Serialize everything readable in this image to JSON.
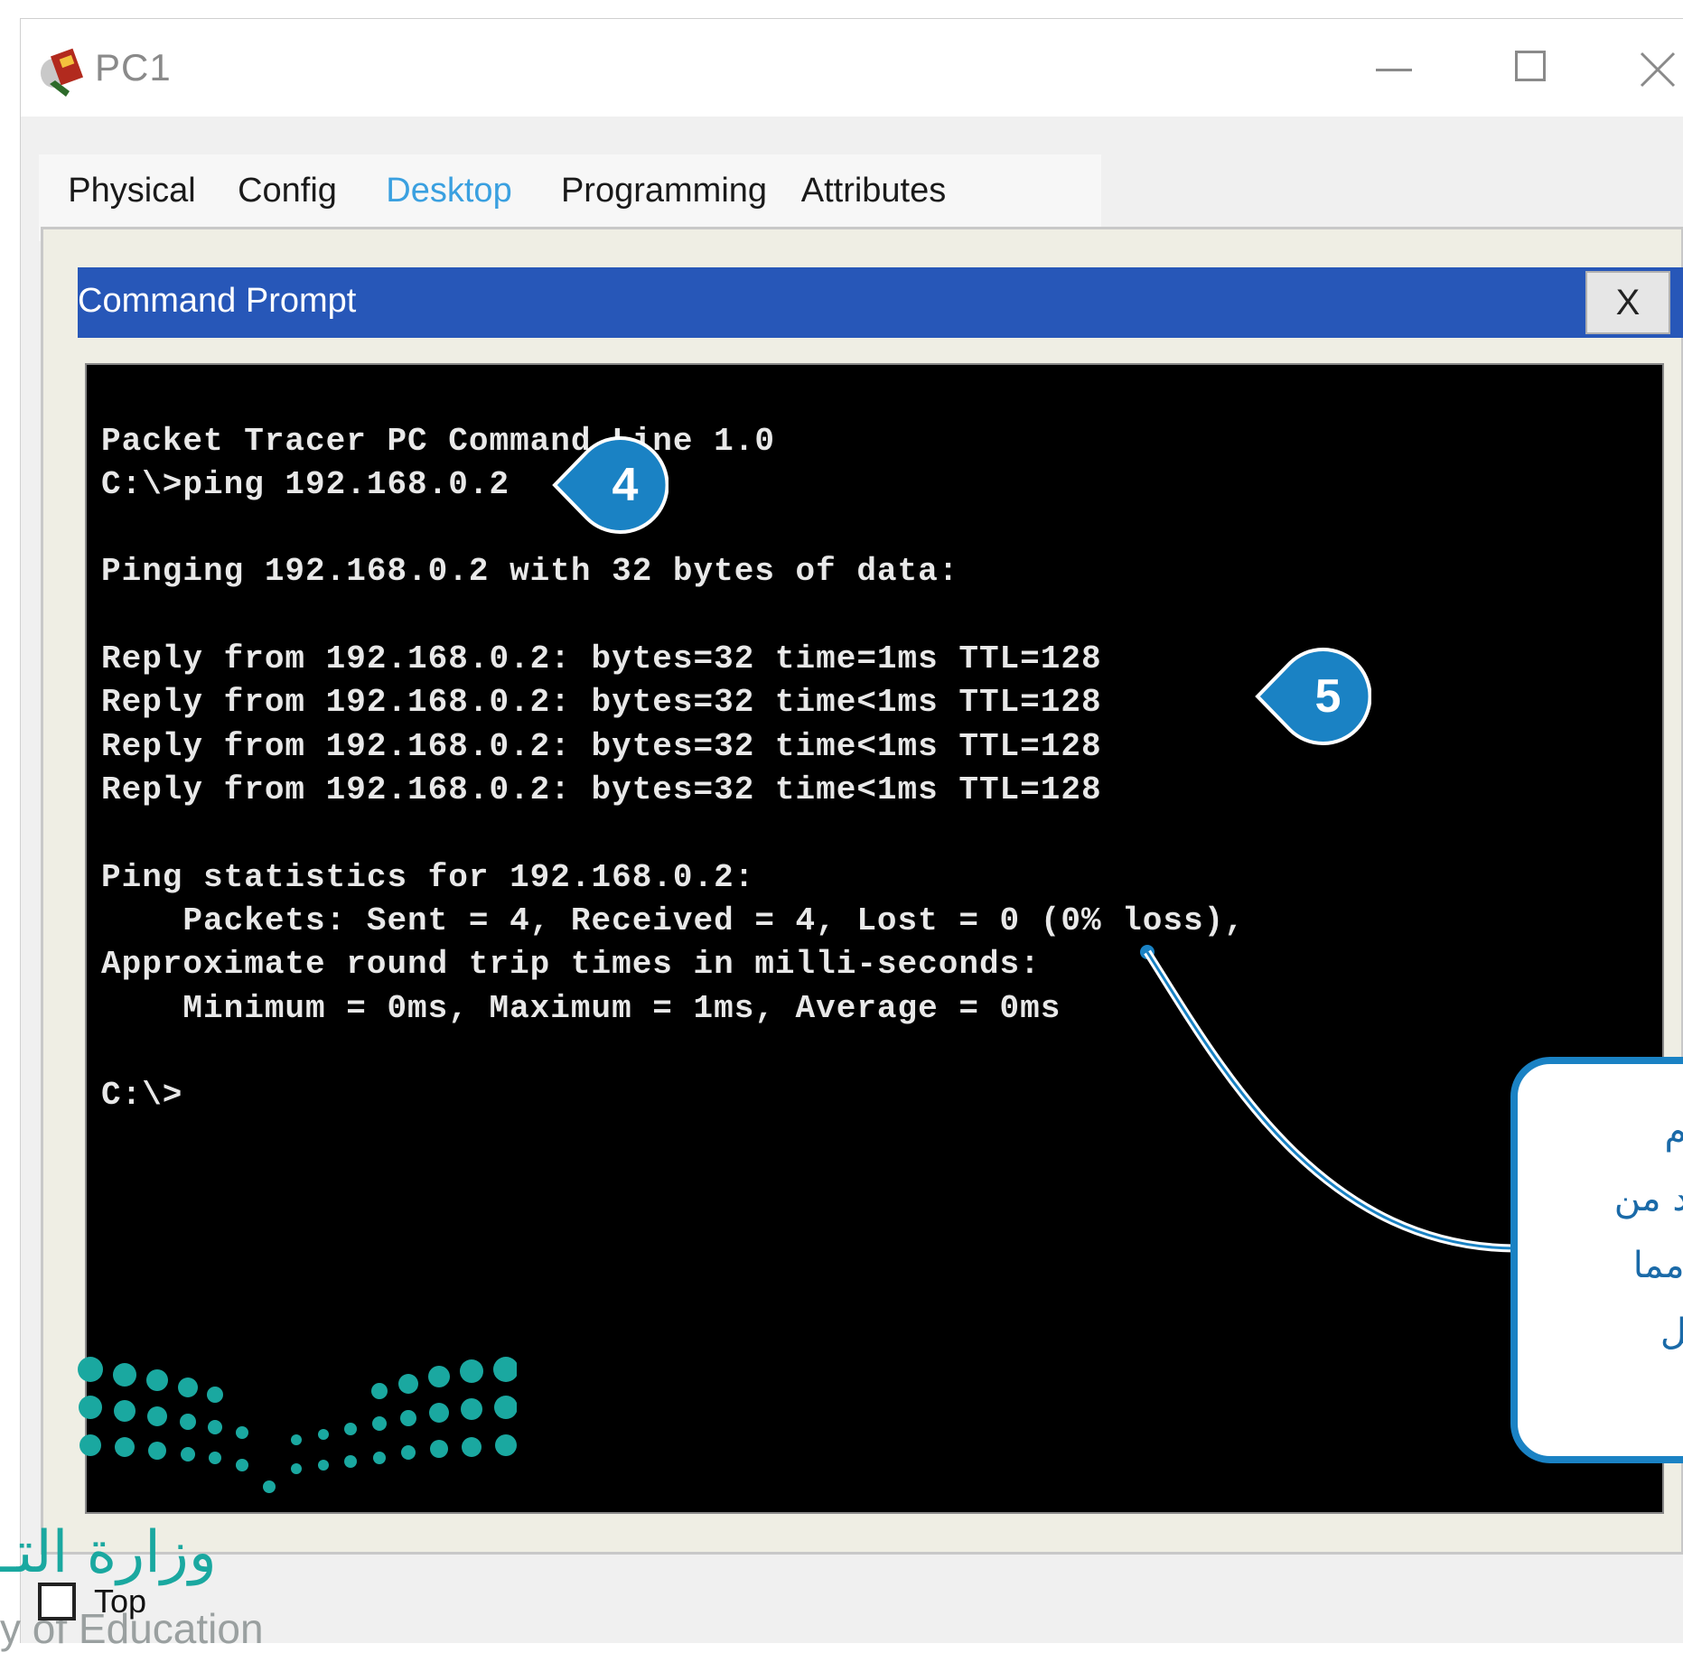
{
  "window": {
    "title": "PC1",
    "icon": "packet-tracer-pc-icon",
    "controls": [
      "minimize",
      "maximize",
      "close"
    ]
  },
  "tabs": [
    {
      "label": "Physical",
      "active": false
    },
    {
      "label": "Config",
      "active": false
    },
    {
      "label": "Desktop",
      "active": true
    },
    {
      "label": "Programming",
      "active": false
    },
    {
      "label": "Attributes",
      "active": false
    }
  ],
  "command_prompt": {
    "title": "Command Prompt",
    "close_label": "X",
    "lines": [
      "Packet Tracer PC Command Line 1.0",
      "C:\\>ping 192.168.0.2",
      "",
      "Pinging 192.168.0.2 with 32 bytes of data:",
      "",
      "Reply from 192.168.0.2: bytes=32 time=1ms TTL=128",
      "Reply from 192.168.0.2: bytes=32 time<1ms TTL=128",
      "Reply from 192.168.0.2: bytes=32 time<1ms TTL=128",
      "Reply from 192.168.0.2: bytes=32 time<1ms TTL=128",
      "",
      "Ping statistics for 192.168.0.2:",
      "    Packets: Sent = 4, Received = 4, Lost = 0 (0% loss),",
      "Approximate round trip times in milli-seconds:",
      "    Minimum = 0ms, Maximum = 1ms, Average = 0ms",
      "",
      "C:\\>"
    ]
  },
  "markers": [
    {
      "number": "4"
    },
    {
      "number": "5"
    }
  ],
  "callout": {
    "lines": [
      "حزم",
      "عدد من",
      "ع، مما",
      "تصل"
    ]
  },
  "footer": {
    "top_checkbox_label": "Top",
    "logo_ar": "وزارة التـ",
    "logo_en": "y of Education"
  },
  "colors": {
    "titlebar_blue": "#2757b8",
    "tab_active": "#2e9ad8",
    "marker": "#1a82c4",
    "terminal_bg": "#000000",
    "terminal_text": "#e8e8e8",
    "logo_teal": "#1aa8a0"
  }
}
